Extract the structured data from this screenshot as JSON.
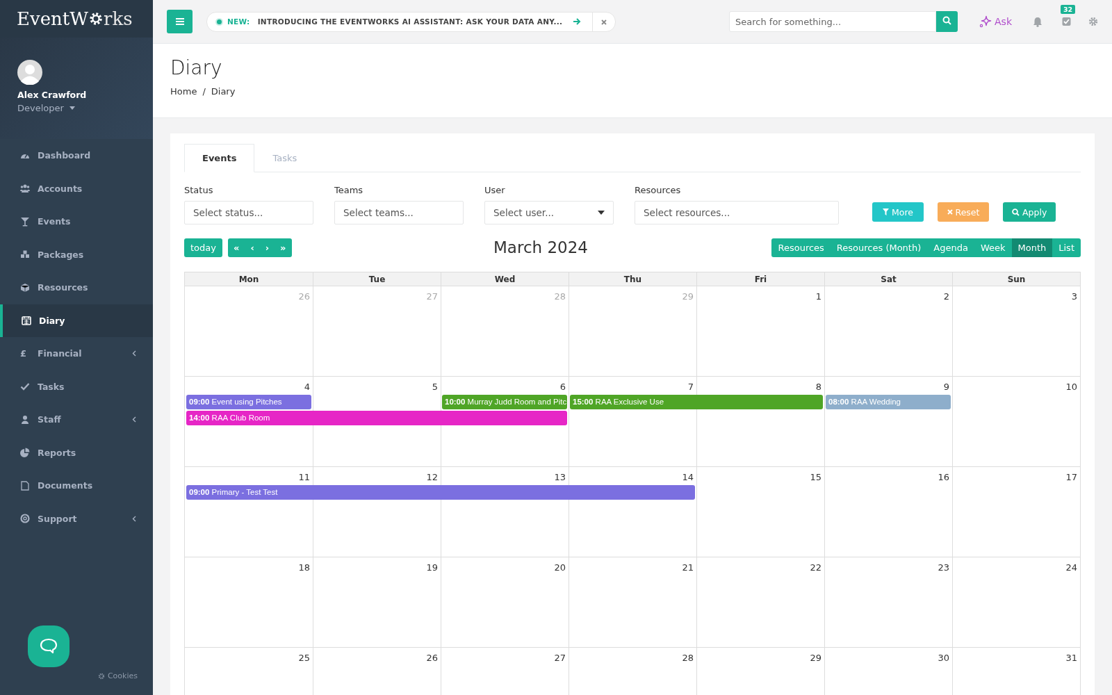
{
  "logo": {
    "before": "EventW",
    "after": "rks"
  },
  "user": {
    "name": "Alex Crawford",
    "role": "Developer"
  },
  "sidebar": {
    "items": [
      {
        "label": "Dashboard",
        "selected": false,
        "expandable": false
      },
      {
        "label": "Accounts",
        "selected": false,
        "expandable": false
      },
      {
        "label": "Events",
        "selected": false,
        "expandable": false
      },
      {
        "label": "Packages",
        "selected": false,
        "expandable": false
      },
      {
        "label": "Resources",
        "selected": false,
        "expandable": false
      },
      {
        "label": "Diary",
        "selected": true,
        "expandable": false
      },
      {
        "label": "Financial",
        "selected": false,
        "expandable": true,
        "glyph": "£"
      },
      {
        "label": "Tasks",
        "selected": false,
        "expandable": false
      },
      {
        "label": "Staff",
        "selected": false,
        "expandable": true
      },
      {
        "label": "Reports",
        "selected": false,
        "expandable": false
      },
      {
        "label": "Documents",
        "selected": false,
        "expandable": false
      },
      {
        "label": "Support",
        "selected": false,
        "expandable": true
      }
    ],
    "cookies": "Cookies"
  },
  "topbar": {
    "announcement": {
      "tag": "NEW:",
      "text": "INTRODUCING THE EVENTWORKS AI ASSISTANT: ASK YOUR DATA ANY..."
    },
    "search": {
      "placeholder": "Search for something..."
    },
    "ask": "Ask",
    "task_count": "32"
  },
  "page": {
    "title": "Diary",
    "breadcrumb": [
      "Home",
      "Diary"
    ],
    "breadcrumb_separator": "/"
  },
  "tabs": [
    {
      "label": "Events",
      "selected": true
    },
    {
      "label": "Tasks",
      "selected": false
    }
  ],
  "filters": [
    {
      "label": "Status",
      "placeholder": "Select status...",
      "kind": "text"
    },
    {
      "label": "Teams",
      "placeholder": "Select teams...",
      "kind": "text"
    },
    {
      "label": "User",
      "placeholder": "Select user...",
      "kind": "dropdown"
    },
    {
      "label": "Resources",
      "placeholder": "Select resources...",
      "kind": "text"
    }
  ],
  "filter_buttons": [
    {
      "label": "More",
      "kind": "more"
    },
    {
      "label": "Reset",
      "kind": "reset"
    },
    {
      "label": "Apply",
      "kind": "apply"
    }
  ],
  "calendar": {
    "today": "today",
    "nav": [
      "«",
      "‹",
      "›",
      "»"
    ],
    "title": "March 2024",
    "views": [
      {
        "label": "Resources",
        "selected": false
      },
      {
        "label": "Resources (Month)",
        "selected": false
      },
      {
        "label": "Agenda",
        "selected": false
      },
      {
        "label": "Week",
        "selected": false
      },
      {
        "label": "Month",
        "selected": true
      },
      {
        "label": "List",
        "selected": false
      }
    ],
    "weekdays": [
      "Mon",
      "Tue",
      "Wed",
      "Thu",
      "Fri",
      "Sat",
      "Sun"
    ],
    "weeks": [
      {
        "days": [
          {
            "day": "26",
            "other_month": true
          },
          {
            "day": "27",
            "other_month": true
          },
          {
            "day": "28",
            "other_month": true
          },
          {
            "day": "29",
            "other_month": true
          },
          {
            "day": "1",
            "other_month": false
          },
          {
            "day": "2",
            "other_month": false
          },
          {
            "day": "3",
            "other_month": false
          }
        ]
      },
      {
        "days": [
          {
            "day": "4",
            "other_month": false
          },
          {
            "day": "5",
            "other_month": false
          },
          {
            "day": "6",
            "other_month": false
          },
          {
            "day": "7",
            "other_month": false
          },
          {
            "day": "8",
            "other_month": false
          },
          {
            "day": "9",
            "other_month": false
          },
          {
            "day": "10",
            "other_month": false
          }
        ],
        "lanes": [
          [
            {
              "kind": "start",
              "time": "09:00",
              "title": "Event using Pitches",
              "color": "#7b6fe0"
            },
            {
              "kind": "empty"
            },
            {
              "kind": "start",
              "time": "10:00",
              "title": "Murray Judd Room and Pitc",
              "color": "#4fa526"
            },
            {
              "kind": "start",
              "time": "15:00",
              "title": "RAA Exclusive Use",
              "color": "#4fa526"
            },
            {
              "kind": "continue"
            },
            {
              "kind": "start",
              "time": "08:00",
              "title": "RAA Wedding",
              "color": "#8eaecb"
            },
            {
              "kind": "empty"
            }
          ],
          [
            {
              "kind": "start",
              "time": "14:00",
              "title": "RAA Club Room",
              "color": "#e626c6"
            },
            {
              "kind": "continue"
            },
            {
              "kind": "continue"
            },
            {
              "kind": "empty"
            },
            {
              "kind": "empty"
            },
            {
              "kind": "empty"
            },
            {
              "kind": "empty"
            }
          ]
        ]
      },
      {
        "days": [
          {
            "day": "11",
            "other_month": false
          },
          {
            "day": "12",
            "other_month": false
          },
          {
            "day": "13",
            "other_month": false
          },
          {
            "day": "14",
            "other_month": false
          },
          {
            "day": "15",
            "other_month": false
          },
          {
            "day": "16",
            "other_month": false
          },
          {
            "day": "17",
            "other_month": false
          }
        ],
        "lanes": [
          [
            {
              "kind": "start",
              "time": "09:00",
              "title": "Primary - Test Test",
              "color": "#7b6fe0"
            },
            {
              "kind": "continue"
            },
            {
              "kind": "continue"
            },
            {
              "kind": "continue"
            },
            {
              "kind": "empty"
            },
            {
              "kind": "empty"
            },
            {
              "kind": "empty"
            }
          ]
        ]
      },
      {
        "days": [
          {
            "day": "18",
            "other_month": false
          },
          {
            "day": "19",
            "other_month": false
          },
          {
            "day": "20",
            "other_month": false
          },
          {
            "day": "21",
            "other_month": false
          },
          {
            "day": "22",
            "other_month": false
          },
          {
            "day": "23",
            "other_month": false
          },
          {
            "day": "24",
            "other_month": false
          }
        ]
      },
      {
        "days": [
          {
            "day": "25",
            "other_month": false
          },
          {
            "day": "26",
            "other_month": false
          },
          {
            "day": "27",
            "other_month": false
          },
          {
            "day": "28",
            "other_month": false
          },
          {
            "day": "29",
            "other_month": false
          },
          {
            "day": "30",
            "other_month": false
          },
          {
            "day": "31",
            "other_month": false
          }
        ]
      }
    ]
  }
}
